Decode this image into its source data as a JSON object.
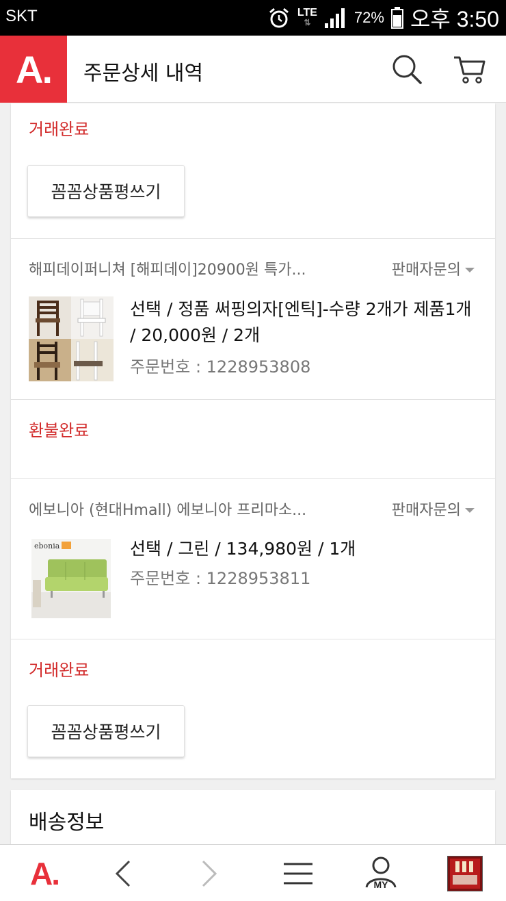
{
  "status_bar": {
    "carrier": "SKT",
    "network": "LTE",
    "battery": "72%",
    "time": "오후 3:50"
  },
  "header": {
    "logo": "A.",
    "title": "주문상세 내역",
    "icons": [
      "search-icon",
      "cart-icon"
    ]
  },
  "orders": [
    {
      "status": "거래완료",
      "review_button": "꼼꼼상품평쓰기"
    },
    {
      "seller": "해피데이퍼니쳐 [해피데이]20900원 특가...",
      "inquiry": "판매자문의",
      "item": "선택 / 정품 써핑의자[엔틱]-수량 2개가 제품1개 / 20,000원 / 2개",
      "order_label": "주문번호 : 1228953808",
      "status": "환불완료"
    },
    {
      "seller": "에보니아 (현대Hmall) 에보니아 프리마소...",
      "inquiry": "판매자문의",
      "item": "선택 / 그린 / 134,980원 / 1개",
      "order_label": "주문번호 : 1228953811",
      "thumb_brand": "ebonia",
      "status": "거래완료",
      "review_button": "꼼꼼상품평쓰기"
    }
  ],
  "shipping": {
    "title": "배송정보"
  },
  "bottom_nav": {
    "logo": "A.",
    "my_label": "MY",
    "icons": [
      "home-logo",
      "back-arrow-icon",
      "forward-arrow-icon",
      "menu-icon",
      "my-icon",
      "recent-thumbnail"
    ]
  },
  "colors": {
    "brand_red": "#e8303a",
    "status_red": "#d22b2b",
    "muted_text": "#777777"
  }
}
